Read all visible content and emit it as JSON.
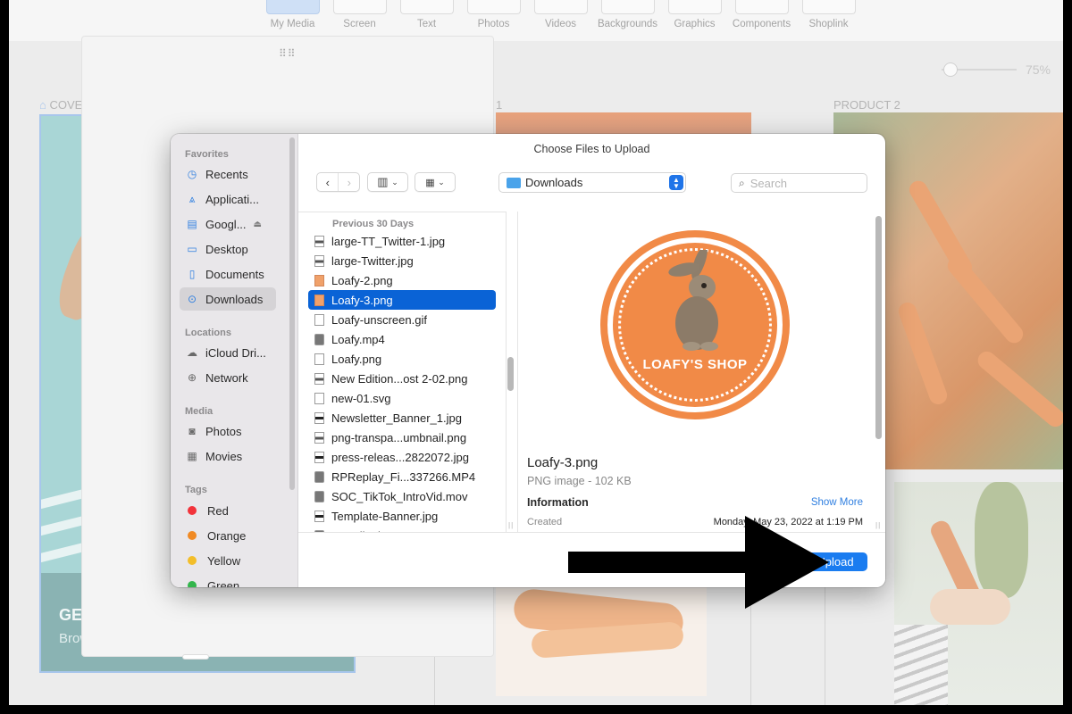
{
  "editor": {
    "tabs": [
      "My Media",
      "Screen",
      "Text",
      "Photos",
      "Videos",
      "Backgrounds",
      "Graphics",
      "Components",
      "Shoplink"
    ],
    "zoom_value": "75%",
    "cover_label": "COVER",
    "page1_label": "1",
    "product2_label": "PRODUCT 2",
    "cover_headline": "GE",
    "cover_subtext": "Brow"
  },
  "dialog": {
    "title": "Choose Files to Upload",
    "sidebar": {
      "favorites_header": "Favorites",
      "favorites": [
        {
          "label": "Recents",
          "icon": "clock-icon"
        },
        {
          "label": "Applicati...",
          "icon": "applications-icon"
        },
        {
          "label": "Googl...",
          "icon": "drive-folder-icon"
        },
        {
          "label": "Desktop",
          "icon": "desktop-icon"
        },
        {
          "label": "Documents",
          "icon": "document-icon"
        },
        {
          "label": "Downloads",
          "icon": "download-icon"
        }
      ],
      "locations_header": "Locations",
      "locations": [
        {
          "label": "iCloud Dri...",
          "icon": "cloud-icon"
        },
        {
          "label": "Network",
          "icon": "globe-icon"
        }
      ],
      "media_header": "Media",
      "media": [
        {
          "label": "Photos",
          "icon": "camera-icon"
        },
        {
          "label": "Movies",
          "icon": "film-icon"
        }
      ],
      "tags_header": "Tags",
      "tags": [
        {
          "label": "Red",
          "color": "#f2333b"
        },
        {
          "label": "Orange",
          "color": "#f08a24"
        },
        {
          "label": "Yellow",
          "color": "#f3be2a"
        },
        {
          "label": "Green",
          "color": "#33b54c"
        }
      ]
    },
    "location": "Downloads",
    "search_placeholder": "Search",
    "list_header": "Previous 30 Days",
    "files": [
      {
        "name": "large-TT_Twitter-1.jpg",
        "icon": "img"
      },
      {
        "name": "large-Twitter.jpg",
        "icon": "img"
      },
      {
        "name": "Loafy-2.png",
        "icon": "png"
      },
      {
        "name": "Loafy-3.png",
        "icon": "png"
      },
      {
        "name": "Loafy-unscreen.gif",
        "icon": "doc"
      },
      {
        "name": "Loafy.mp4",
        "icon": "vid"
      },
      {
        "name": "Loafy.png",
        "icon": "doc"
      },
      {
        "name": "New Edition...ost 2-02.png",
        "icon": "img"
      },
      {
        "name": "new-01.svg",
        "icon": "doc"
      },
      {
        "name": "Newsletter_Banner_1.jpg",
        "icon": "bar"
      },
      {
        "name": "png-transpa...umbnail.png",
        "icon": "img"
      },
      {
        "name": "press-releas...2822072.jpg",
        "icon": "bar"
      },
      {
        "name": "RPReplay_Fi...337266.MP4",
        "icon": "vid"
      },
      {
        "name": "SOC_TikTok_IntroVid.mov",
        "icon": "vid"
      },
      {
        "name": "Template-Banner.jpg",
        "icon": "bar"
      },
      {
        "name": "test_tiktok.mov",
        "icon": "vid"
      }
    ],
    "selected_file": "Loafy-3.png",
    "preview": {
      "logo_text": "LOAFY'S SHOP",
      "name": "Loafy-3.png",
      "type": "PNG image - 102 KB",
      "info_label": "Information",
      "show_more": "Show More",
      "created_label": "Created",
      "created_value": "Monday, May 23, 2022 at 1:19 PM"
    },
    "upload_label": "Upload"
  }
}
